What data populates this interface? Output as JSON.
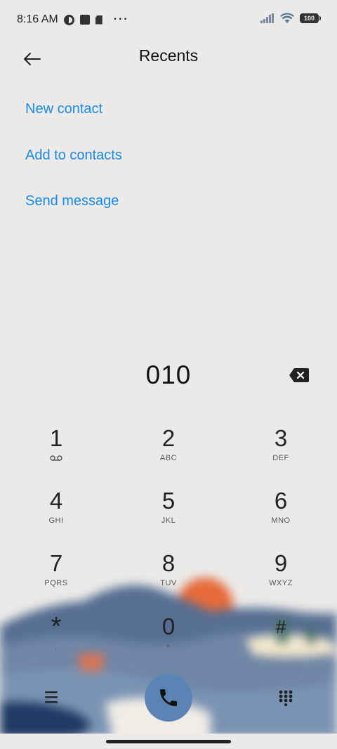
{
  "status_bar": {
    "time": "8:16 AM",
    "overflow": "···",
    "battery": "100",
    "icons": [
      "data-saver-icon",
      "square-notification-icon",
      "sim-card-icon",
      "signal-icon",
      "wifi-icon",
      "battery-icon"
    ]
  },
  "header": {
    "title": "Recents",
    "back_icon": "back-arrow-icon"
  },
  "actions": {
    "new_contact": "New contact",
    "add_to_contacts": "Add to contacts",
    "send_message": "Send message"
  },
  "dialer": {
    "number": "010",
    "keys": [
      {
        "digit": "1",
        "letters": ""
      },
      {
        "digit": "2",
        "letters": "ABC"
      },
      {
        "digit": "3",
        "letters": "DEF"
      },
      {
        "digit": "4",
        "letters": "GHI"
      },
      {
        "digit": "5",
        "letters": "JKL"
      },
      {
        "digit": "6",
        "letters": "MNO"
      },
      {
        "digit": "7",
        "letters": "PQRS"
      },
      {
        "digit": "8",
        "letters": "TUV"
      },
      {
        "digit": "9",
        "letters": "WXYZ"
      },
      {
        "digit": "*",
        "letters": ","
      },
      {
        "digit": "0",
        "letters": "+"
      },
      {
        "digit": "#",
        "letters": ""
      }
    ]
  },
  "colors": {
    "accent": "#1b8ae6",
    "call_button": "#5b84b4",
    "background": "#ebeae8"
  }
}
